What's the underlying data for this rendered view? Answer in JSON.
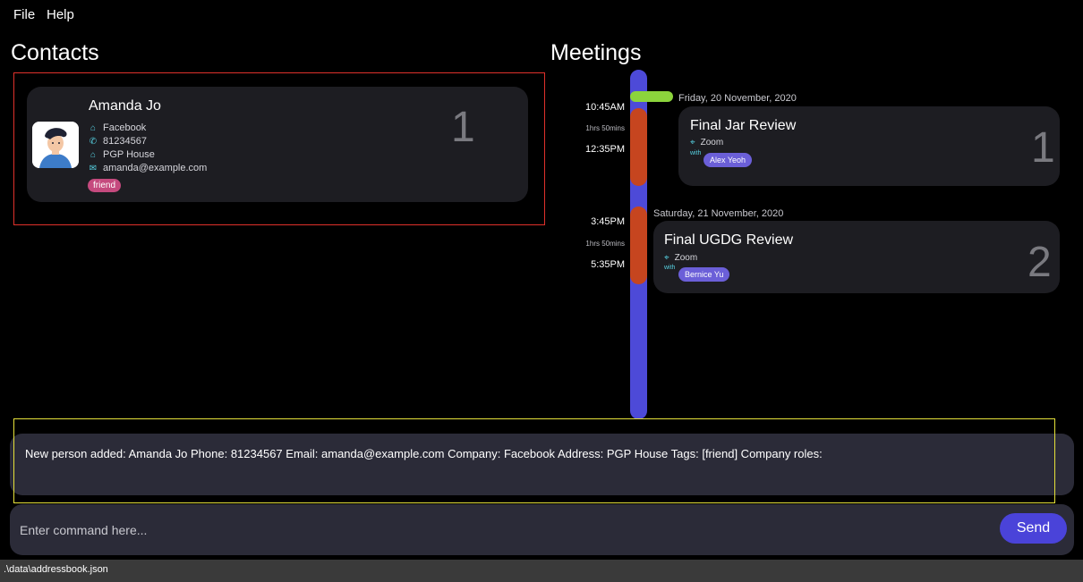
{
  "menu": {
    "file": "File",
    "help": "Help"
  },
  "contacts": {
    "heading": "Contacts",
    "items": [
      {
        "index": "1",
        "name": "Amanda Jo",
        "company": "Facebook",
        "phone": "81234567",
        "address": "PGP House",
        "email": "amanda@example.com",
        "tag": "friend"
      }
    ]
  },
  "meetings": {
    "heading": "Meetings",
    "items": [
      {
        "index": "1",
        "date": "Friday, 20 November, 2020",
        "start": "10:45AM",
        "duration": "1hrs 50mins",
        "end": "12:35PM",
        "title": "Final Jar Review",
        "location": "Zoom",
        "with_label": "with",
        "participant": "Alex Yeoh"
      },
      {
        "index": "2",
        "date": "Saturday, 21 November, 2020",
        "start": "3:45PM",
        "duration": "1hrs 50mins",
        "end": "5:35PM",
        "title": "Final UGDG Review",
        "location": "Zoom",
        "with_label": "with",
        "participant": "Bernice Yu"
      }
    ]
  },
  "result": {
    "text": "New person added: Amanda Jo Phone: 81234567 Email: amanda@example.com Company: Facebook Address: PGP House Tags: [friend] Company roles:"
  },
  "command": {
    "placeholder": "Enter command here...",
    "value": "",
    "send_label": "Send"
  },
  "status": {
    "path": ".\\data\\addressbook.json"
  },
  "icons": {
    "company": "building-icon",
    "phone": "phone-icon",
    "address": "home-icon",
    "email": "mail-icon",
    "location": "map-pin-icon"
  },
  "colors": {
    "timeline": "#4d4ad8",
    "meeting_segment": "#c6451f",
    "today_marker": "#8cd43c",
    "tag_friend": "#c54a7e",
    "participant_tag": "#6b5fd8",
    "send_button": "#4a43d9",
    "contact_highlight": "#e0312b",
    "result_highlight": "#e6e23a"
  }
}
